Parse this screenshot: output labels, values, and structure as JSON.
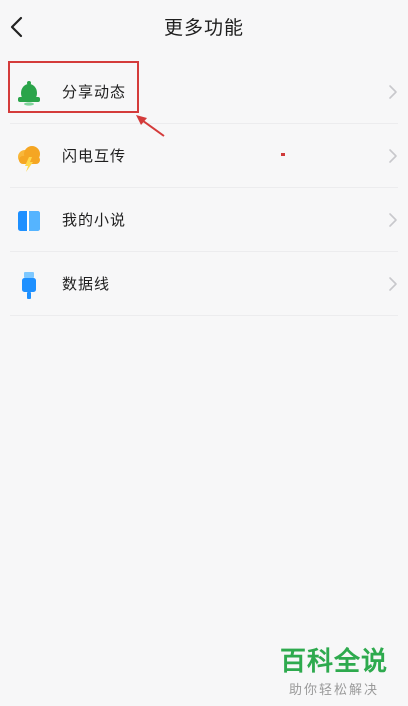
{
  "header": {
    "title": "更多功能",
    "back_icon": "chevron-left-icon"
  },
  "menu": {
    "items": [
      {
        "label": "分享动态",
        "icon": "bell-icon",
        "icon_color": "#2aa44a"
      },
      {
        "label": "闪电互传",
        "icon": "lightning-cloud-icon",
        "icon_color": "#f5a623"
      },
      {
        "label": "我的小说",
        "icon": "book-icon",
        "icon_color": "#1e90ff"
      },
      {
        "label": "数据线",
        "icon": "usb-cable-icon",
        "icon_color": "#1e90ff"
      }
    ]
  },
  "annotation": {
    "highlight_color": "#d43b3b"
  },
  "watermark": {
    "title": "百科全说",
    "subtitle": "助你轻松解决",
    "color": "#2eaa4e"
  }
}
